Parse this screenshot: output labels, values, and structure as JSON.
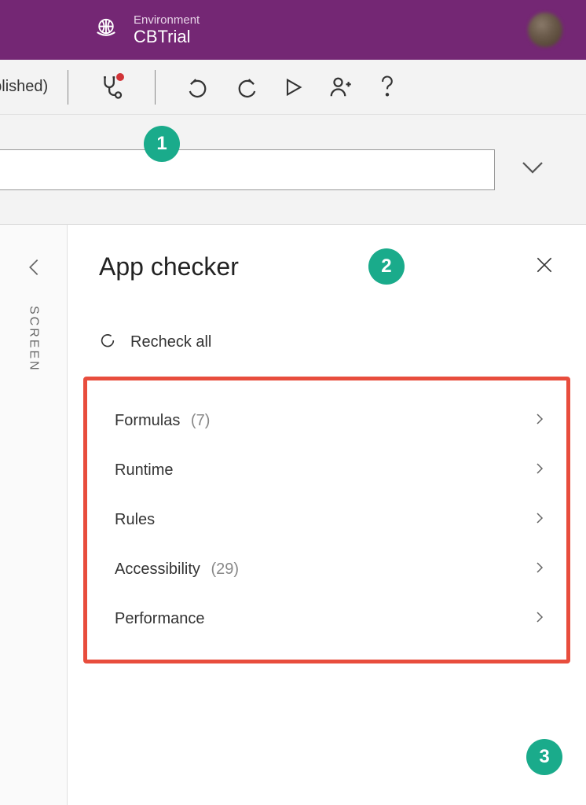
{
  "header": {
    "env_label": "Environment",
    "env_name": "CBTrial"
  },
  "toolbar": {
    "published_text": "ublished)"
  },
  "callouts": {
    "c1": "1",
    "c2": "2",
    "c3": "3"
  },
  "left_rail": {
    "screen_label": "SCREEN"
  },
  "checker": {
    "title": "App checker",
    "recheck_label": "Recheck all",
    "categories": [
      {
        "label": "Formulas",
        "count": "(7)"
      },
      {
        "label": "Runtime",
        "count": ""
      },
      {
        "label": "Rules",
        "count": ""
      },
      {
        "label": "Accessibility",
        "count": "(29)"
      },
      {
        "label": "Performance",
        "count": ""
      }
    ]
  }
}
